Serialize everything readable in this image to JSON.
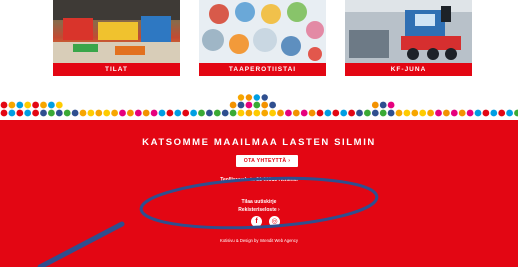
{
  "tiles": [
    {
      "caption": "TILAT"
    },
    {
      "caption": "TAAPEROTIISTAI"
    },
    {
      "caption": "KF-JUNA"
    }
  ],
  "footer": {
    "headline": "KATSOMME MAAILMAA LASTEN SILMIN",
    "contact_button": "OTA YHTEYTTÄ ›",
    "address": "Teollisuuskatu 21 00510 Helsinki",
    "newsletter": "Tilaa uutiskirje",
    "privacy": "Rekisteriseloste ›",
    "social": [
      {
        "icon": "facebook-icon",
        "glyph": "f"
      },
      {
        "icon": "instagram-icon",
        "glyph": "◎"
      }
    ],
    "credits": "Kotisivu & Design by Intendit Web Agency"
  },
  "colors": {
    "brand_red": "#e30613",
    "annotation": "#2f4f8f"
  }
}
